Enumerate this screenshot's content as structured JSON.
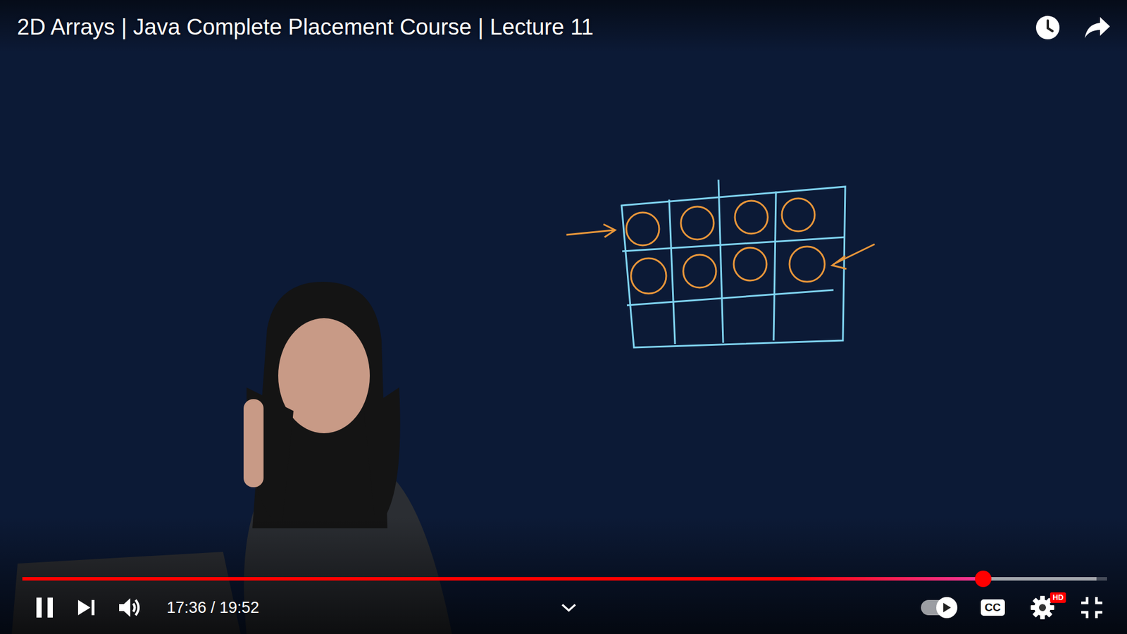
{
  "video": {
    "title": "2D Arrays | Java Complete Placement Course | Lecture 11"
  },
  "player": {
    "playing": true,
    "muted": false,
    "time": "17:36 / 19:52"
  },
  "progress": {
    "level": 0.886,
    "buffered": 0.99
  },
  "autoplay": {
    "on": true
  },
  "captions": {
    "label": "CC",
    "on": false
  },
  "settings": {
    "badge": "HD"
  }
}
